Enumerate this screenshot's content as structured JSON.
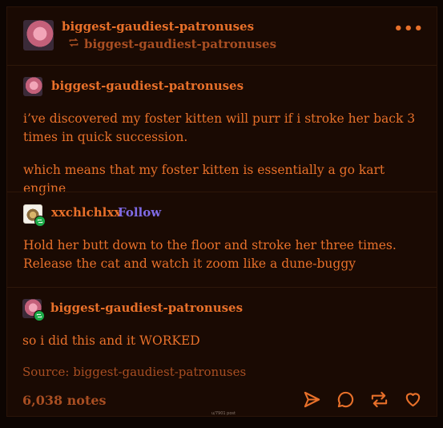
{
  "post": {
    "author": "biggest-gaudiest-patronuses",
    "reblogged_from": "biggest-gaudiest-patronuses",
    "more_menu": "•••",
    "thread": [
      {
        "blog": "biggest-gaudiest-patronuses",
        "paragraphs": [
          "i’ve discovered my foster kitten will purr if i stroke her back 3 times in quick succession.",
          "which means that my foster kitten is essentially a go kart engine"
        ]
      },
      {
        "blog": "xxchlchlxx",
        "follow_label": "Follow",
        "paragraphs": [
          "Hold her butt down to the floor and stroke her three times. Release the cat and watch it zoom like a dune-buggy"
        ]
      },
      {
        "blog": "biggest-gaudiest-patronuses",
        "paragraphs": [
          "so i did this and it WORKED"
        ]
      }
    ],
    "source": "Source: biggest-gaudiest-patronuses",
    "notes": "6,038 notes",
    "watermark": "u/7901 post"
  },
  "colors": {
    "background": "#1a0a03",
    "accent": "#e8702a",
    "muted": "#a84e22",
    "follow": "#7f6ae4",
    "reblog_badge": "#1cab48"
  },
  "icons": [
    "more-icon",
    "reblog-icon",
    "send-icon",
    "reply-icon",
    "reblog-action-icon",
    "like-icon"
  ]
}
